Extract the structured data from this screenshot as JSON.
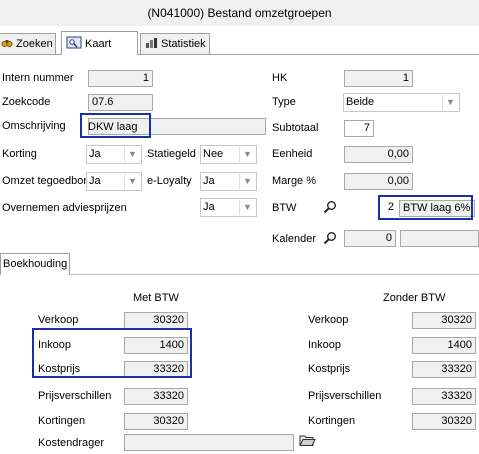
{
  "window": {
    "title": "(N041000) Bestand omzetgroepen"
  },
  "tabs": [
    {
      "label": "Zoeken",
      "icon": "search-binoculars-icon"
    },
    {
      "label": "Kaart",
      "icon": "card-icon"
    },
    {
      "label": "Statistiek",
      "icon": "statistics-icon"
    }
  ],
  "form": {
    "intern_nummer": {
      "label": "Intern nummer",
      "value": "1"
    },
    "zoekcode": {
      "label": "Zoekcode",
      "value": "07.6"
    },
    "omschrijving": {
      "label": "Omschrijving",
      "value": "DKW laag"
    },
    "korting": {
      "label": "Korting",
      "value": "Ja"
    },
    "statiegeld": {
      "label": "Statiegeld",
      "value": "Nee"
    },
    "omzet_tegoedbon": {
      "label": "Omzet tegoedbon",
      "value": "Ja"
    },
    "eloyalty": {
      "label": "e-Loyalty",
      "value": "Ja"
    },
    "overnemen": {
      "label": "Overnemen adviesprijzen",
      "value": "Ja"
    },
    "hk": {
      "label": "HK",
      "value": "1"
    },
    "type": {
      "label": "Type",
      "value": "Beide"
    },
    "subtotaal": {
      "label": "Subtotaal",
      "value": "7"
    },
    "eenheid": {
      "label": "Eenheid",
      "value": "0,00"
    },
    "marge": {
      "label": "Marge %",
      "value": "0,00"
    },
    "btw": {
      "label": "BTW",
      "code": "2",
      "desc": "BTW laag 6%"
    },
    "kalender": {
      "label": "Kalender",
      "value": "0",
      "desc": ""
    }
  },
  "boekhouding": {
    "tab_label": "Boekhouding",
    "met_btw_header": "Met BTW",
    "zonder_btw_header": "Zonder BTW",
    "rows": [
      {
        "label": "Verkoop",
        "met": "30320",
        "zonder": "30320"
      },
      {
        "label": "Inkoop",
        "met": "1400",
        "zonder": "1400"
      },
      {
        "label": "Kostprijs",
        "met": "33320",
        "zonder": "33320"
      },
      {
        "label": "Prijsverschillen",
        "met": "33320",
        "zonder": "33320"
      },
      {
        "label": "Kortingen",
        "met": "30320",
        "zonder": "30320"
      }
    ],
    "kostendrager": {
      "label": "Kostendrager",
      "value": ""
    }
  },
  "colors": {
    "highlight": "#1a2fb0"
  }
}
